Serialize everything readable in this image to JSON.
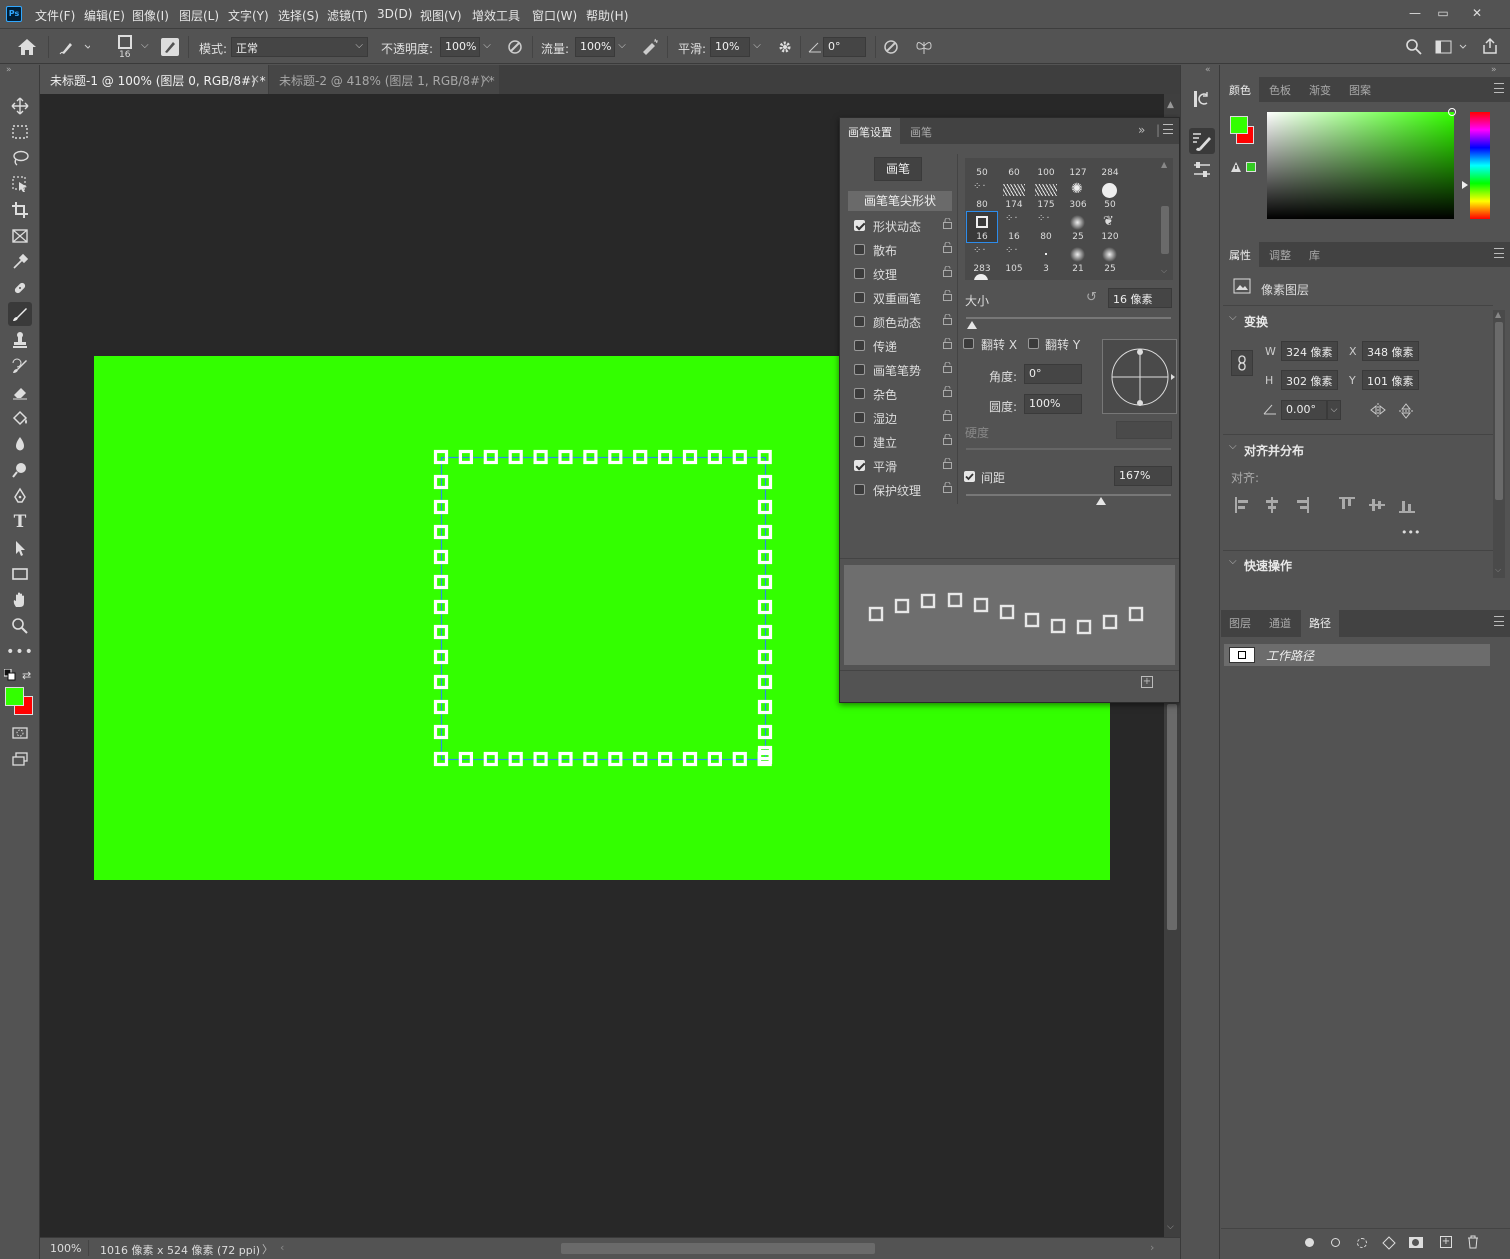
{
  "app": {
    "logo": "Ps"
  },
  "menu": [
    "文件(F)",
    "编辑(E)",
    "图像(I)",
    "图层(L)",
    "文字(Y)",
    "选择(S)",
    "滤镜(T)",
    "3D(D)",
    "视图(V)",
    "增效工具",
    "窗口(W)",
    "帮助(H)"
  ],
  "options": {
    "brush_size": "16",
    "mode_label": "模式:",
    "mode_value": "正常",
    "opacity_label": "不透明度:",
    "opacity_value": "100%",
    "flow_label": "流量:",
    "flow_value": "100%",
    "smooth_label": "平滑:",
    "smooth_value": "10%",
    "angle_value": "0°"
  },
  "tabs": [
    {
      "label": "未标题-1 @ 100% (图层 0, RGB/8#) *",
      "close": "×"
    },
    {
      "label": "未标题-2 @ 418% (图层 1, RGB/8#) *",
      "close": "×"
    }
  ],
  "status": {
    "zoom": "100%",
    "doc_info": "1016 像素 x 524 像素 (72 ppi)",
    "arrow": "〉"
  },
  "brush_panel": {
    "tabs": [
      "画笔设置",
      "画笔"
    ],
    "brush_button": "画笔",
    "tip_shape": "画笔笔尖形状",
    "options": [
      {
        "label": "形状动态",
        "checked": true
      },
      {
        "label": "散布",
        "checked": false
      },
      {
        "label": "纹理",
        "checked": false
      },
      {
        "label": "双重画笔",
        "checked": false
      },
      {
        "label": "颜色动态",
        "checked": false
      },
      {
        "label": "传递",
        "checked": false
      },
      {
        "label": "画笔笔势",
        "checked": false
      },
      {
        "label": "杂色",
        "checked": false
      },
      {
        "label": "湿边",
        "checked": false
      },
      {
        "label": "建立",
        "checked": false
      },
      {
        "label": "平滑",
        "checked": true
      },
      {
        "label": "保护纹理",
        "checked": false
      }
    ],
    "tip_sizes": [
      "50",
      "60",
      "100",
      "127",
      "284",
      "80",
      "174",
      "175",
      "306",
      "50",
      "16",
      "16",
      "80",
      "25",
      "120",
      "283",
      "105",
      "3",
      "21",
      "25"
    ],
    "size_label": "大小",
    "size_value": "16 像素",
    "flip_x": "翻转 X",
    "flip_y": "翻转 Y",
    "angle_label": "角度:",
    "angle_value": "0°",
    "roundness_label": "圆度:",
    "roundness_value": "100%",
    "hardness_label": "硬度",
    "spacing_label": "间距",
    "spacing_value": "167%",
    "size_level": 0.03,
    "spacing_level": 0.66
  },
  "color_panel": {
    "tabs": [
      "颜色",
      "色板",
      "渐变",
      "图案"
    ],
    "foreground": "#33ff00",
    "background": "#ff0000",
    "hue_color": "#33ff00"
  },
  "properties_panel": {
    "tabs": [
      "属性",
      "调整",
      "库"
    ],
    "layer_type": "像素图层",
    "transform_title": "变换",
    "w_label": "W",
    "w_value": "324 像素",
    "x_label": "X",
    "x_value": "348 像素",
    "h_label": "H",
    "h_value": "302 像素",
    "y_label": "Y",
    "y_value": "101 像素",
    "angle_value": "0.00°",
    "align_title": "对齐并分布",
    "align_label": "对齐:",
    "more": "•••",
    "quick_title": "快速操作"
  },
  "layers_panel": {
    "tabs": [
      "图层",
      "通道",
      "路径"
    ],
    "path_name": "工作路径"
  },
  "colors": {
    "canvas_green": "#33ff00",
    "accent_blue": "#2d8ceb"
  }
}
